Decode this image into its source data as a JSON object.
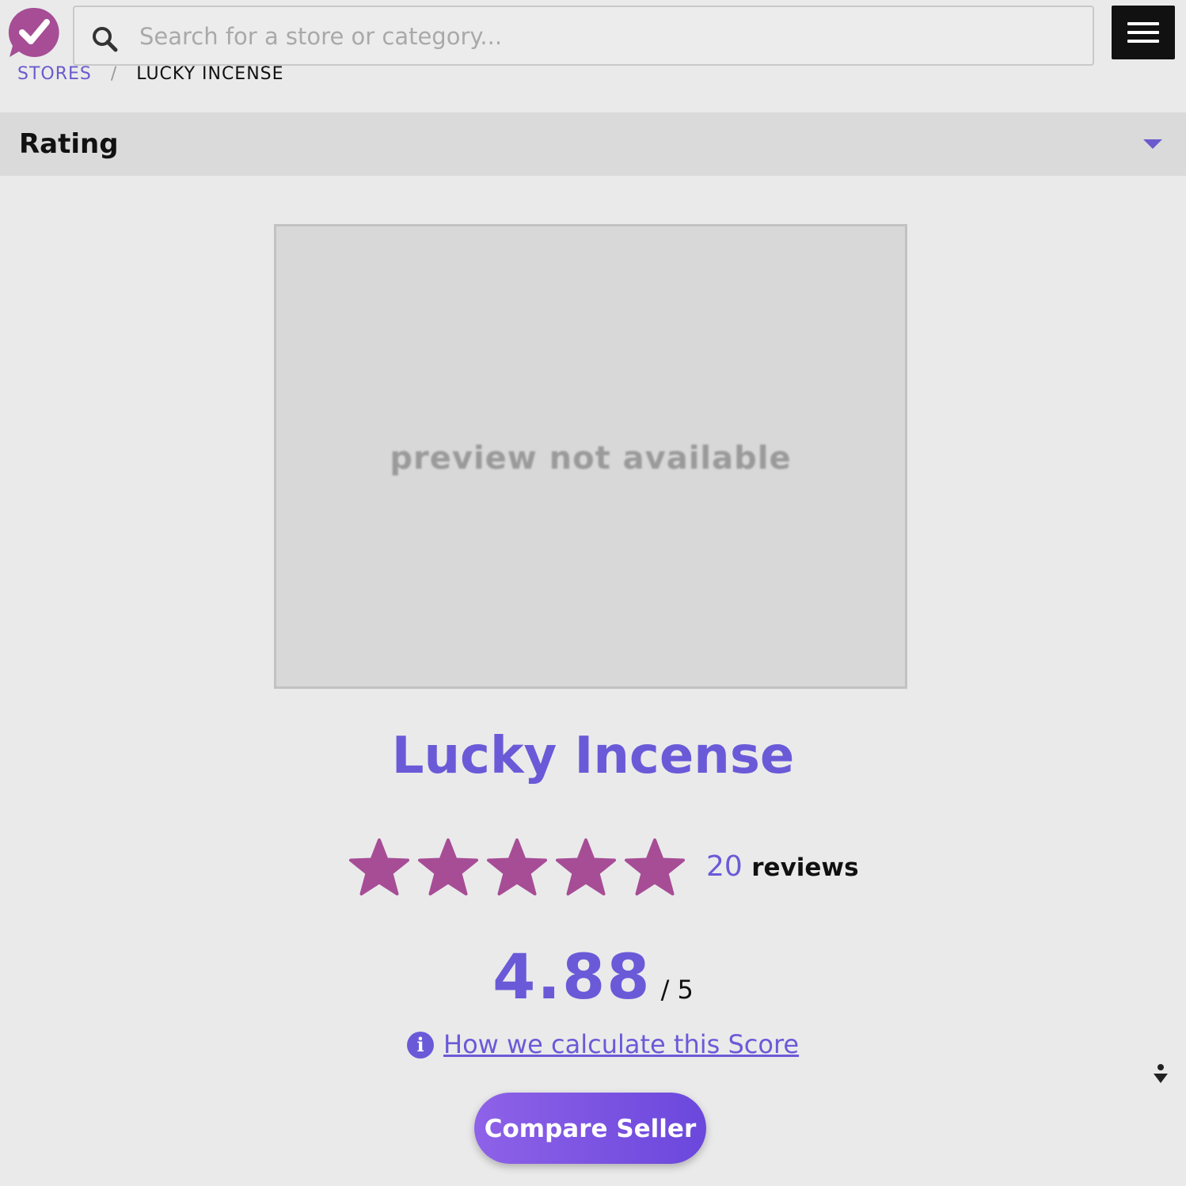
{
  "header": {
    "search": {
      "placeholder": "Search for a store or category...",
      "value": ""
    }
  },
  "breadcrumb": {
    "items": [
      {
        "label": "STORES"
      },
      {
        "label": "LUCKY INCENSE"
      }
    ],
    "separator": "/"
  },
  "rating_section": {
    "label": "Rating"
  },
  "preview": {
    "text": "preview not available"
  },
  "store": {
    "name": "Lucky Incense",
    "stars_filled": 5,
    "stars_total": 5,
    "review_count": "20",
    "review_word": "reviews",
    "score": "4.88",
    "score_max": "/ 5",
    "calc_link_text": "How we calculate this Score",
    "compare_button": "Compare Seller"
  },
  "colors": {
    "accent": "#6a5ad8",
    "star": "#a64d96",
    "logo": "#a64d96",
    "background": "#eaeaea"
  }
}
